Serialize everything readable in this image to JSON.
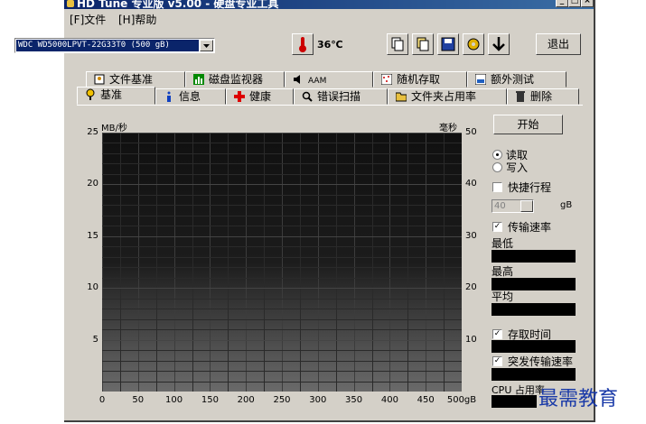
{
  "window": {
    "title": "HD Tune 专业版 v5.00 - 硬盘专业工具"
  },
  "menu": [
    {
      "label": "[F]文件"
    },
    {
      "label": "[H]帮助"
    }
  ],
  "toolbar": {
    "drive_selected": "WDC WD5000LPVT-22G33T0 (500 gB)",
    "temperature": "36℃",
    "exit_label": "退出"
  },
  "tabs_top": [
    {
      "label": "文件基准",
      "icon": "file-benchmark-icon"
    },
    {
      "label": "磁盘监视器",
      "icon": "disk-monitor-icon"
    },
    {
      "label": "AAM",
      "icon": "speaker-icon"
    },
    {
      "label": "随机存取",
      "icon": "random-access-icon"
    },
    {
      "label": "额外测试",
      "icon": "extra-tests-icon"
    }
  ],
  "tabs_bottom": [
    {
      "label": "基准",
      "icon": "benchmark-icon"
    },
    {
      "label": "信息",
      "icon": "info-icon"
    },
    {
      "label": "健康",
      "icon": "health-icon"
    },
    {
      "label": "错误扫描",
      "icon": "error-scan-icon"
    },
    {
      "label": "文件夹占用率",
      "icon": "folder-icon"
    },
    {
      "label": "删除",
      "icon": "delete-icon"
    }
  ],
  "chart_data": {
    "type": "line",
    "y_left_label": "MB/秒",
    "y_right_label": "毫秒",
    "x_unit": "gB",
    "x_ticks": [
      "0",
      "50",
      "100",
      "150",
      "200",
      "250",
      "300",
      "350",
      "400",
      "450",
      "500gB"
    ],
    "y_left_ticks": [
      "25",
      "20",
      "15",
      "10",
      "5"
    ],
    "y_right_ticks": [
      "50",
      "40",
      "30",
      "20",
      "10"
    ],
    "xlim": [
      0,
      500
    ],
    "ylim_left": [
      0,
      25
    ],
    "ylim_right": [
      0,
      50
    ],
    "grid": true,
    "series": []
  },
  "controls": {
    "start_label": "开始",
    "read_label": "读取",
    "write_label": "写入",
    "short_stroke_label": "快捷行程",
    "short_stroke_value": "40",
    "short_stroke_unit": "gB",
    "transfer_rate_label": "传输速率",
    "min_label": "最低",
    "max_label": "最高",
    "avg_label": "平均",
    "access_time_label": "存取时间",
    "burst_rate_label": "突发传输速率",
    "cpu_label": "CPU 占用率"
  },
  "watermark": "最需教育"
}
